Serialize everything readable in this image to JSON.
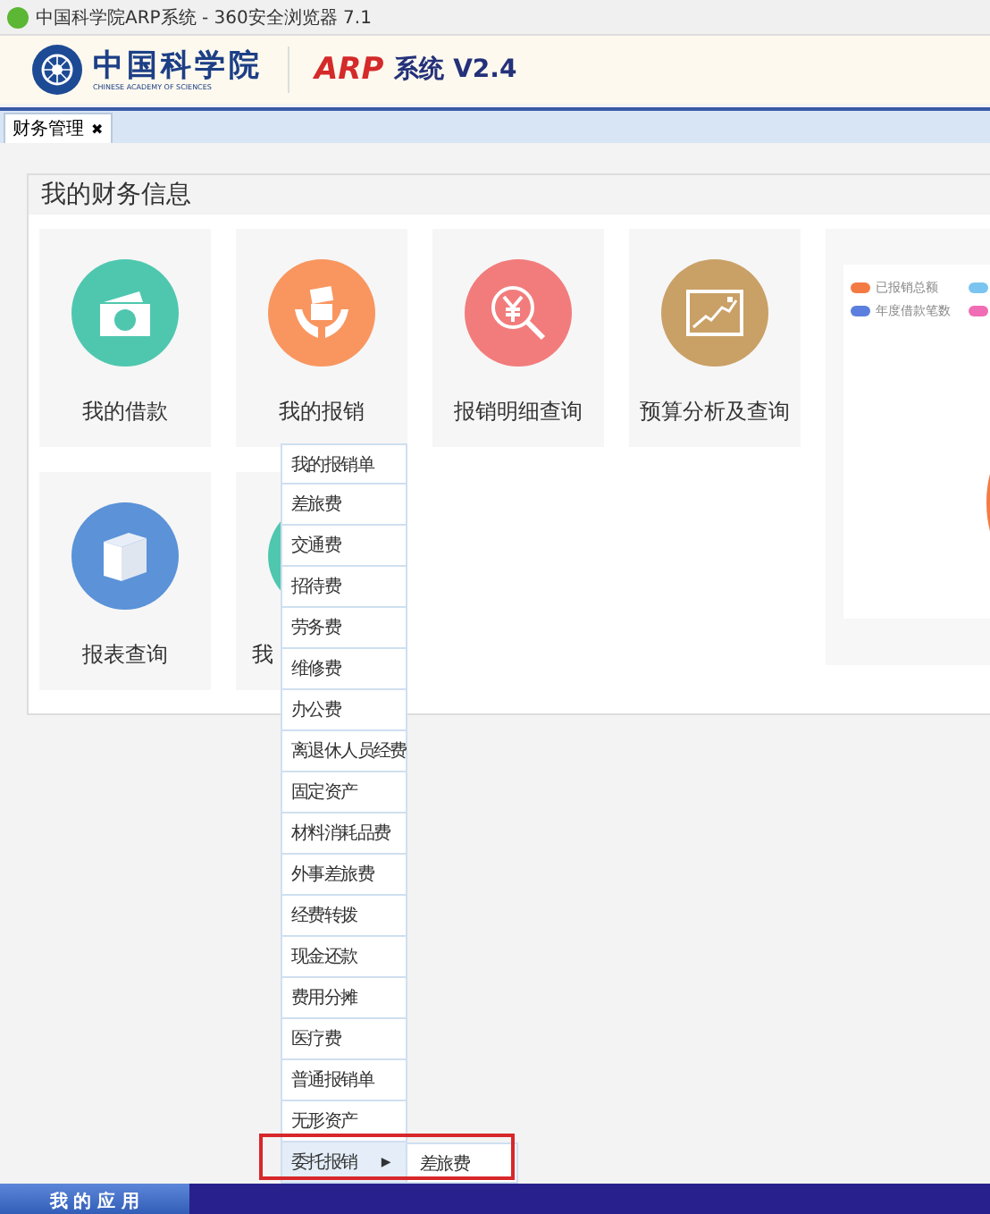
{
  "window": {
    "title": "中国科学院ARP系统 - 360安全浏览器 7.1"
  },
  "header": {
    "org_name": "中国科学院",
    "org_name_en": "CHINESE ACADEMY OF SCIENCES",
    "product": "ARP",
    "product_suffix": "系统 V2.4"
  },
  "tabs": [
    {
      "label": "财务管理",
      "selected": true,
      "close": "✖"
    }
  ],
  "panel": {
    "title": "我的财务信息",
    "cards": [
      {
        "label": "我的借款",
        "kind": "wallet",
        "color": "#4fc7af"
      },
      {
        "label": "我的报销",
        "kind": "hands",
        "color": "#f99660"
      },
      {
        "label": "报销明细查询",
        "kind": "search",
        "color": "#f27c7c"
      },
      {
        "label": "预算分析及查询",
        "kind": "chart",
        "color": "#c9a066"
      },
      {
        "label": "报表查询",
        "kind": "box",
        "color": "#5b92d8"
      },
      {
        "label": "我",
        "kind": "covered",
        "color": "#4fc7af"
      }
    ]
  },
  "chart": {
    "legend": [
      {
        "label": "已报销总额",
        "color": "#f47a44"
      },
      {
        "color": "#7cc4f0"
      },
      {
        "label": "年度借款笔数",
        "color": "#5b7fde"
      },
      {
        "color": "#f06cb4"
      }
    ]
  },
  "menu": {
    "items": [
      {
        "label": "我的报销单",
        "selected": false
      },
      {
        "label": "差旅费",
        "selected": false
      },
      {
        "label": "交通费",
        "selected": false
      },
      {
        "label": "招待费",
        "selected": false
      },
      {
        "label": "劳务费",
        "selected": false
      },
      {
        "label": "维修费",
        "selected": false
      },
      {
        "label": "办公费",
        "selected": false
      },
      {
        "label": "离退休人员经费",
        "selected": false
      },
      {
        "label": "固定资产",
        "selected": false
      },
      {
        "label": "材料消耗品费",
        "selected": false
      },
      {
        "label": "外事差旅费",
        "selected": false
      },
      {
        "label": "经费转拨",
        "selected": false
      },
      {
        "label": "现金还款",
        "selected": false
      },
      {
        "label": "费用分摊",
        "selected": false
      },
      {
        "label": "医疗费",
        "selected": false
      },
      {
        "label": "普通报销单",
        "selected": false
      },
      {
        "label": "无形资产",
        "selected": false
      },
      {
        "label": "委托报销",
        "selected": true,
        "arrow": "▶",
        "submenu": [
          {
            "label": "差旅费",
            "selected": false
          }
        ]
      }
    ]
  },
  "taskbar": {
    "start": "我 的 应 用"
  }
}
